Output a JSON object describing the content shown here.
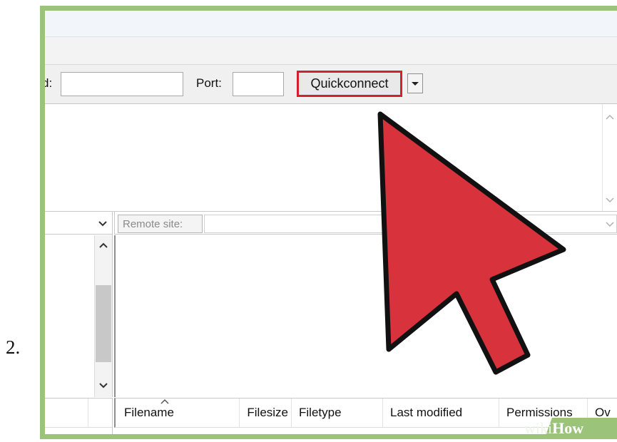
{
  "step": {
    "number": "2."
  },
  "quickconnect_bar": {
    "password_label_fragment": "d:",
    "port_label": "Port:",
    "quickconnect_label": "Quickconnect"
  },
  "remote": {
    "label": "Remote site:"
  },
  "file_list": {
    "columns": [
      "Filename",
      "Filesize",
      "Filetype",
      "Last modified",
      "Permissions",
      "Ov"
    ]
  },
  "watermark": {
    "wiki": "wiki",
    "how": "How"
  },
  "colors": {
    "frame_green": "#9cc37a",
    "highlight_red": "#d3202c",
    "arrow_red": "#d8323c"
  },
  "icons": [
    "dropdown-arrow-icon",
    "chevron-up-icon",
    "chevron-down-icon",
    "sort-ascending-icon",
    "pointer-arrow-icon"
  ]
}
